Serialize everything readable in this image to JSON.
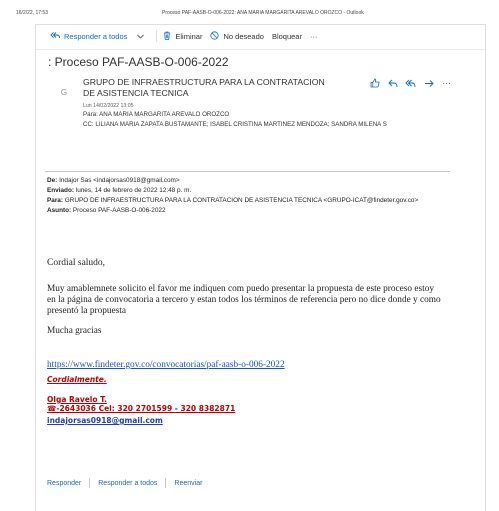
{
  "print_header": {
    "date": "16/2/22, 17:53",
    "title": "Proceso PAF-AASB-O-006-2022: ANA MARIA MARGARITA AREVALO OROZCO - Outlook"
  },
  "toolbar": {
    "reply_all": "Responder a todos",
    "delete": "Eliminar",
    "junk": "No deseado",
    "block": "Bloquear",
    "more": "···"
  },
  "subject": ": Proceso PAF-AASB-O-006-2022",
  "message": {
    "avatar_letter": "G",
    "sender": "GRUPO DE INFRAESTRUCTURA PARA LA CONTRATACION DE ASISTENCIA TECNICA",
    "date": "Lun 14/02/2022 13:05",
    "to": "Para:  ANA MARIA MARGARITA AREVALO OROZCO",
    "cc": "CC:  LILIANA MARIA ZAPATA BUSTAMANTE; ISABEL CRISTINA MARTINEZ MENDOZA; SANDRA MILENA S",
    "more": "···"
  },
  "forward": {
    "from_label": "De:",
    "from_value": " Indajor Sas <indajorsas0918@gmail.com>",
    "sent_label": "Enviado:",
    "sent_value": " lunes, 14 de febrero de 2022 12:48 p. m.",
    "to_label": "Para:",
    "to_value": " GRUPO DE INFRAESTRUCTURA PARA LA CONTRATACION DE ASISTENCIA TECNICA <GRUPO-ICAT@findeter.gov.co>",
    "subject_label": "Asunto:",
    "subject_value": " Proceso PAF-AASB-O-006-2022"
  },
  "body": {
    "greeting": "Cordial saludo,",
    "paragraph": "Muy amablemnete solicito el favor me indiquen com puedo presentar la propuesta de este proceso estoy en la página de convocatoria a tercero y estan todos los términos de referencia pero no dice donde y como presentó la propuesta",
    "thanks": "Mucha gracias",
    "link": "https://www.findeter.gov.co/convocatorias/paf-aasb-o-006-2022"
  },
  "signature": {
    "closing": "Cordialmente.",
    "name": "Olga Ravelo T.",
    "phone": "☎-2643036 Cel: 320 2701599 - 320 8382871",
    "email": "indajorsas0918@gmail.com"
  },
  "bottom_actions": {
    "reply": "Responder",
    "reply_all": "Responder a todos",
    "forward": "Reenviar"
  },
  "colors": {
    "accent": "#0f6cbd",
    "signature_red": "#c00000",
    "link_blue": "#1155cc"
  }
}
